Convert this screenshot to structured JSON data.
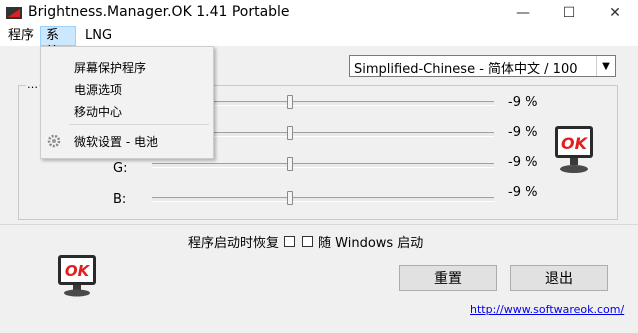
{
  "window": {
    "title": "Brightness.Manager.OK 1.41 Portable",
    "minimize": "—",
    "maximize": "☐",
    "close": "✕"
  },
  "menu": {
    "items": [
      {
        "label": "程序"
      },
      {
        "label": "系统"
      },
      {
        "label": "LNG"
      }
    ],
    "open_menu": "系统",
    "dropdown": [
      {
        "label": "屏幕保护程序"
      },
      {
        "label": "电源选项"
      },
      {
        "label": "移动中心"
      },
      {
        "label": "微软设置 - 电池",
        "icon": "gear-icon"
      }
    ]
  },
  "language": {
    "selected": "Simplified-Chinese - 简体中文 / 100",
    "arrow": "▼"
  },
  "group": {
    "title": "…"
  },
  "sliders": [
    {
      "label": "",
      "value": "-9 %"
    },
    {
      "label": "",
      "value": "-9 %"
    },
    {
      "label": "G:",
      "value": "-9 %"
    },
    {
      "label": "B:",
      "value": "-9 %"
    }
  ],
  "restore": {
    "label": "程序启动时恢复",
    "with_windows_label": "随 Windows 启动",
    "restore_checked": false,
    "windows_checked": false
  },
  "buttons": {
    "reset": "重置",
    "exit": "退出"
  },
  "link": "http://www.softwareok.com/",
  "logo_text": "OK",
  "colors": {
    "accent_red": "#e41e1e",
    "menu_highlight": "#cce8ff",
    "link": "#0000ee"
  }
}
